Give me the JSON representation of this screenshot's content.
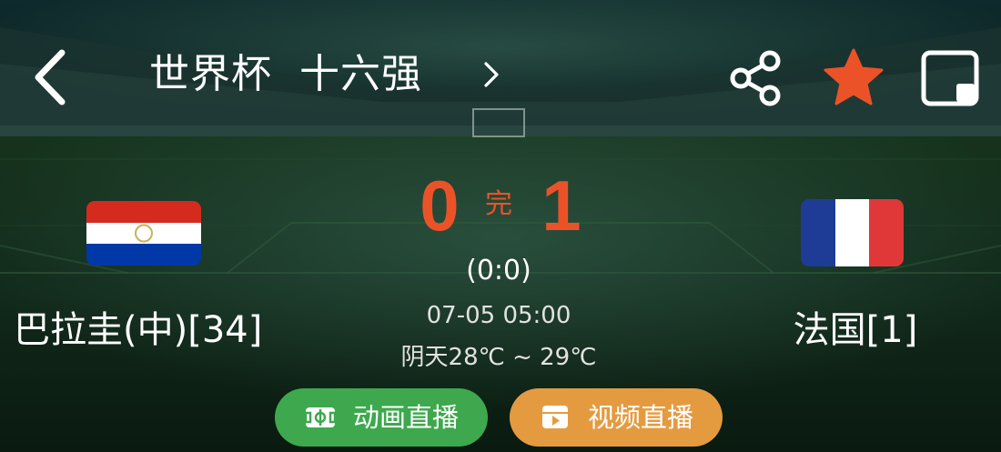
{
  "header": {
    "competition": "世界杯",
    "stage": "十六强",
    "icons": {
      "back": "chevron-left-icon",
      "stage_link": "chevron-right-icon",
      "share": "share-icon",
      "favorite": "star-icon",
      "pip": "picture-in-picture-icon"
    }
  },
  "match": {
    "home": {
      "name": "巴拉圭(中)[34]",
      "score": "0"
    },
    "away": {
      "name": "法国[1]",
      "score": "1"
    },
    "status": "完",
    "halftime": "(0:0)",
    "datetime": "07-05 05:00",
    "weather": "阴天28℃ ~ 29℃"
  },
  "actions": {
    "animation_live": "动画直播",
    "video_live": "视频直播"
  },
  "colors": {
    "score": "#ec5228",
    "favorite_star": "#ec5228",
    "animation_button": "#3ea84e",
    "video_button": "#e49b40"
  }
}
